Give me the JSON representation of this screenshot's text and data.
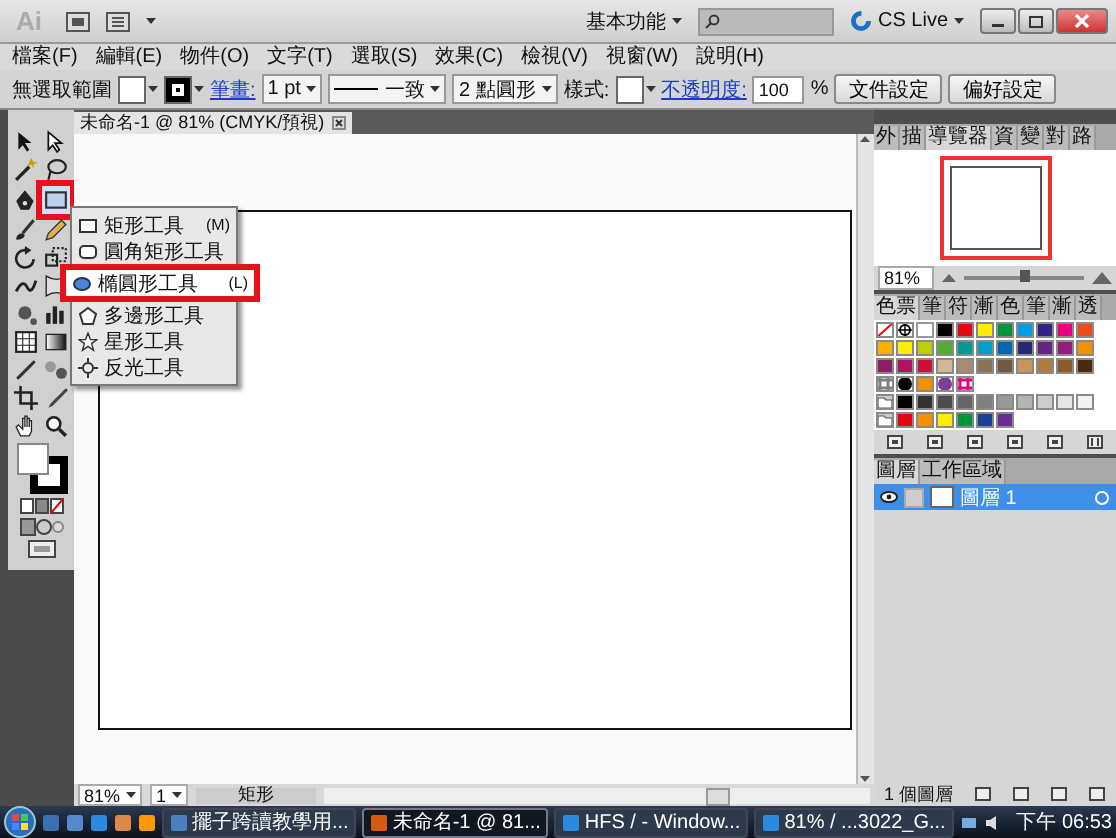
{
  "title_bar": {
    "logo": "Ai",
    "workspace": "基本功能",
    "cs_live": "CS Live"
  },
  "menu": [
    "檔案(F)",
    "編輯(E)",
    "物件(O)",
    "文字(T)",
    "選取(S)",
    "效果(C)",
    "檢視(V)",
    "視窗(W)",
    "說明(H)"
  ],
  "control_bar": {
    "selection": "無選取範圍",
    "stroke_label": "筆畫:",
    "stroke_weight": "1 pt",
    "stroke_profile": "一致",
    "brush": "2 點圓形",
    "style_label": "樣式:",
    "opacity_label": "不透明度:",
    "opacity": "100",
    "percent": "%",
    "buttons": [
      "文件設定",
      "偏好設定"
    ]
  },
  "toolbox": {
    "shape_tool_highlighted": true
  },
  "document_tab": {
    "title": "未命名-1 @ 81% (CMYK/預視)"
  },
  "flyout": [
    {
      "label": "矩形工具",
      "shortcut": "(M)",
      "selected": false,
      "highlighted": false
    },
    {
      "label": "圓角矩形工具",
      "selected": false,
      "highlighted": false
    },
    {
      "label": "橢圓形工具",
      "shortcut": "(L)",
      "selected": true,
      "highlighted": true
    },
    {
      "label": "多邊形工具",
      "selected": false,
      "highlighted": false
    },
    {
      "label": "星形工具",
      "selected": false,
      "highlighted": false
    },
    {
      "label": "反光工具",
      "selected": false,
      "highlighted": false
    }
  ],
  "navigator": {
    "tabs": [
      {
        "label": "外",
        "selected": false
      },
      {
        "label": "描",
        "selected": false
      },
      {
        "label": "導覽器",
        "selected": true
      },
      {
        "label": "資",
        "selected": false
      },
      {
        "label": "變",
        "selected": false
      },
      {
        "label": "對",
        "selected": false
      },
      {
        "label": "路",
        "selected": false
      }
    ],
    "zoom": "81%",
    "level": 0.5
  },
  "swatches": {
    "tabs": [
      {
        "label": "色票",
        "selected": true
      },
      {
        "label": "筆",
        "selected": false
      },
      {
        "label": "符",
        "selected": false
      },
      {
        "label": "漸",
        "selected": false
      },
      {
        "label": "色",
        "selected": false
      },
      {
        "label": "筆",
        "selected": false
      },
      {
        "label": "漸",
        "selected": false
      },
      {
        "label": "透",
        "selected": false
      }
    ],
    "rows": [
      [
        {
          "kind": "none"
        },
        {
          "kind": "registration"
        },
        {
          "kind": "solid",
          "color": "#ffffff"
        },
        {
          "kind": "solid",
          "color": "#000000"
        },
        {
          "kind": "solid",
          "color": "#e30613"
        },
        {
          "kind": "solid",
          "color": "#ffed00"
        },
        {
          "kind": "solid",
          "color": "#009640"
        },
        {
          "kind": "solid",
          "color": "#009fe3"
        },
        {
          "kind": "solid",
          "color": "#312783"
        },
        {
          "kind": "solid",
          "color": "#e6007e"
        },
        {
          "kind": "solid",
          "color": "#e94e1b"
        }
      ],
      [
        {
          "kind": "solid",
          "color": "#f9b200"
        },
        {
          "kind": "solid",
          "color": "#feee00"
        },
        {
          "kind": "solid",
          "color": "#bccf00"
        },
        {
          "kind": "solid",
          "color": "#52ae32"
        },
        {
          "kind": "solid",
          "color": "#009a93"
        },
        {
          "kind": "solid",
          "color": "#00a0c6"
        },
        {
          "kind": "solid",
          "color": "#0069b4"
        },
        {
          "kind": "solid",
          "color": "#2a2a74"
        },
        {
          "kind": "solid",
          "color": "#662483"
        },
        {
          "kind": "solid",
          "color": "#951b81"
        },
        {
          "kind": "solid",
          "color": "#f39200"
        }
      ],
      [
        {
          "kind": "solid",
          "color": "#8e1f66"
        },
        {
          "kind": "solid",
          "color": "#b2125e"
        },
        {
          "kind": "solid",
          "color": "#c9123f"
        },
        {
          "kind": "solid",
          "color": "#d1b89a"
        },
        {
          "kind": "solid",
          "color": "#a58b6f"
        },
        {
          "kind": "solid",
          "color": "#8c7357"
        },
        {
          "kind": "solid",
          "color": "#6f5a43"
        },
        {
          "kind": "solid",
          "color": "#c8955a"
        },
        {
          "kind": "solid",
          "color": "#b07b3e"
        },
        {
          "kind": "solid",
          "color": "#8a5a2b"
        },
        {
          "kind": "solid",
          "color": "#4a2b10"
        }
      ],
      [
        {
          "kind": "pattern",
          "color": "#808080"
        },
        {
          "kind": "radial",
          "color": "#000000"
        },
        {
          "kind": "solid",
          "color": "#f39200"
        },
        {
          "kind": "radial",
          "color": "#7f3f98"
        },
        {
          "kind": "pattern",
          "color": "#e6007e"
        }
      ],
      [
        {
          "kind": "group"
        },
        {
          "kind": "solid",
          "color": "#000000"
        },
        {
          "kind": "solid",
          "color": "#333333"
        },
        {
          "kind": "solid",
          "color": "#4d4d4d"
        },
        {
          "kind": "solid",
          "color": "#666666"
        },
        {
          "kind": "solid",
          "color": "#808080"
        },
        {
          "kind": "solid",
          "color": "#999999"
        },
        {
          "kind": "solid",
          "color": "#b3b3b3"
        },
        {
          "kind": "solid",
          "color": "#cccccc"
        },
        {
          "kind": "solid",
          "color": "#e6e6e6"
        },
        {
          "kind": "solid",
          "color": "#f2f2f2"
        }
      ],
      [
        {
          "kind": "group"
        },
        {
          "kind": "solid",
          "color": "#e30613"
        },
        {
          "kind": "solid",
          "color": "#f39200"
        },
        {
          "kind": "solid",
          "color": "#ffed00"
        },
        {
          "kind": "solid",
          "color": "#009640"
        },
        {
          "kind": "solid",
          "color": "#1d3f95"
        },
        {
          "kind": "solid",
          "color": "#6b2c91"
        }
      ]
    ]
  },
  "layers": {
    "tabs": [
      {
        "label": "圖層",
        "selected": true
      },
      {
        "label": "工作區域",
        "selected": false
      }
    ],
    "items": [
      {
        "name": "圖層 1",
        "visible": true,
        "selected": true
      }
    ],
    "footer": "1 個圖層"
  },
  "status_bar": {
    "zoom": "81%",
    "artboard": "1",
    "tool": "矩形"
  },
  "taskbar": {
    "tasks": [
      {
        "label": "擺子跨讀教學用...",
        "selected": false
      },
      {
        "label": "未命名-1 @ 81...",
        "selected": true
      },
      {
        "label": "HFS / - Window...",
        "selected": false
      },
      {
        "label": "81% / ...3022_G...",
        "selected": false
      }
    ],
    "clock": "下午 06:53"
  }
}
